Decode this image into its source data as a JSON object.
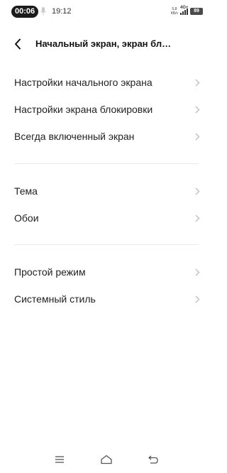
{
  "status_bar": {
    "recording_time": "00:06",
    "clock": "19:12",
    "net_speed_value": "5,8",
    "net_speed_unit": "КБ/с",
    "network_type": "4G+",
    "battery_level": "89"
  },
  "header": {
    "title": "Начальный экран, экран бл…"
  },
  "groups": [
    {
      "items": [
        {
          "label": "Настройки начального экрана"
        },
        {
          "label": "Настройки экрана блокировки"
        },
        {
          "label": "Всегда включенный экран"
        }
      ]
    },
    {
      "items": [
        {
          "label": "Тема"
        },
        {
          "label": "Обои"
        }
      ]
    },
    {
      "items": [
        {
          "label": "Простой режим"
        },
        {
          "label": "Системный стиль"
        }
      ]
    }
  ],
  "icons": {
    "back": "chevron-left-icon",
    "item_arrow": "chevron-right-icon",
    "nav_menu": "menu-icon",
    "nav_home": "home-icon",
    "nav_back": "return-icon"
  },
  "colors": {
    "background": "#ffffff",
    "text": "#1f1f1f",
    "chevron": "#bdbdbd",
    "divider": "#ebebeb"
  }
}
